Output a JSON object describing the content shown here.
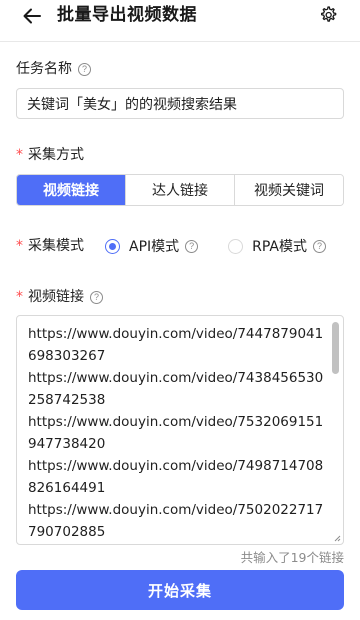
{
  "header": {
    "title": "批量导出视频数据",
    "back_icon": "arrow-left-icon",
    "settings_icon": "gear-icon"
  },
  "task_name": {
    "label": "任务名称",
    "value": "关键词「美女」的的视频搜索结果"
  },
  "collect_method": {
    "label": "采集方式",
    "options": [
      "视频链接",
      "达人链接",
      "视频关键词"
    ],
    "selected": "视频链接"
  },
  "collect_mode": {
    "label": "采集模式",
    "options": [
      "API模式",
      "RPA模式"
    ],
    "selected": "API模式"
  },
  "video_links": {
    "label": "视频链接",
    "value": "https://www.douyin.com/video/7447879041698303267\nhttps://www.douyin.com/video/7438456530258742538\nhttps://www.douyin.com/video/7532069151947738420\nhttps://www.douyin.com/video/7498714708826164491\nhttps://www.douyin.com/video/7502022717790702885",
    "count_text": "共输入了19个链接"
  },
  "start_button": {
    "label": "开始采集"
  },
  "colors": {
    "accent": "#4f6ef7",
    "required": "#ff4d4f",
    "muted": "#8c8c8c"
  }
}
